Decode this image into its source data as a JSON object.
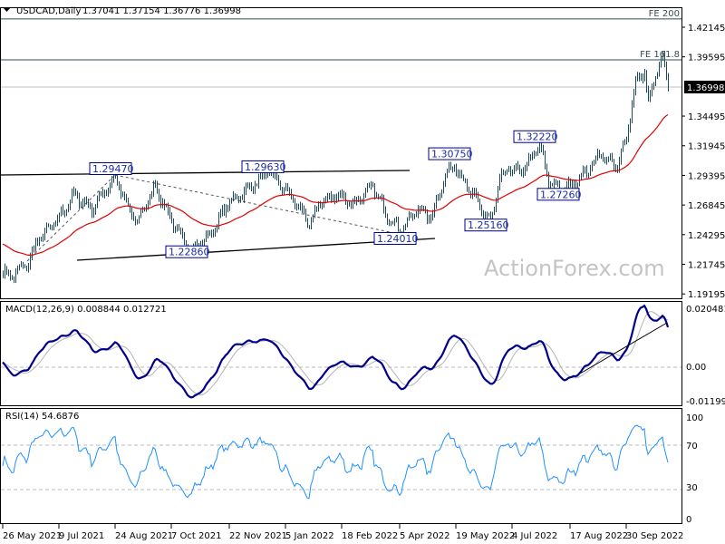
{
  "header": {
    "symbol": "USDCAD,Daily",
    "ohlc": "1.37041 1.37154 1.36776 1.36998"
  },
  "watermark": "ActionForex.com",
  "chart_data": [
    {
      "type": "ohlc",
      "title": "USDCAD,Daily",
      "ylim": [
        1.1882,
        1.4386
      ],
      "yticks": [
        "1.42145",
        "1.39595",
        "1.34495",
        "1.31945",
        "1.29395",
        "1.26845",
        "1.24295",
        "1.21745",
        "1.19195"
      ],
      "ytick_values": [
        1.42145,
        1.39595,
        1.34495,
        1.31945,
        1.29395,
        1.26845,
        1.24295,
        1.21745,
        1.19195
      ],
      "current_price": "1.36998",
      "current_value": 1.36998,
      "bars": 368,
      "close_keypoints": [
        [
          0,
          1.2109
        ],
        [
          4,
          1.207
        ],
        [
          14,
          1.2186
        ],
        [
          19,
          1.2381
        ],
        [
          29,
          1.2537
        ],
        [
          39,
          1.2771
        ],
        [
          49,
          1.2654
        ],
        [
          62,
          1.2927
        ],
        [
          69,
          1.2654
        ],
        [
          74,
          1.2537
        ],
        [
          84,
          1.2849
        ],
        [
          91,
          1.2615
        ],
        [
          99,
          1.2381
        ],
        [
          104,
          1.2303
        ],
        [
          114,
          1.242
        ],
        [
          124,
          1.2693
        ],
        [
          134,
          1.281
        ],
        [
          146,
          1.2966
        ],
        [
          154,
          1.2849
        ],
        [
          164,
          1.2654
        ],
        [
          169,
          1.2498
        ],
        [
          174,
          1.2693
        ],
        [
          184,
          1.2771
        ],
        [
          194,
          1.2693
        ],
        [
          204,
          1.2849
        ],
        [
          211,
          1.2615
        ],
        [
          219,
          1.2459
        ],
        [
          229,
          1.2654
        ],
        [
          236,
          1.2576
        ],
        [
          244,
          1.2927
        ],
        [
          249,
          1.3045
        ],
        [
          254,
          1.2888
        ],
        [
          259,
          1.2771
        ],
        [
          264,
          1.2654
        ],
        [
          269,
          1.2537
        ],
        [
          274,
          1.2888
        ],
        [
          279,
          1.3006
        ],
        [
          286,
          1.2966
        ],
        [
          296,
          1.3201
        ],
        [
          301,
          1.2888
        ],
        [
          309,
          1.281
        ],
        [
          316,
          1.2888
        ],
        [
          324,
          1.3006
        ],
        [
          329,
          1.3123
        ],
        [
          339,
          1.3006
        ],
        [
          344,
          1.3278
        ],
        [
          349,
          1.3746
        ],
        [
          354,
          1.3824
        ],
        [
          356,
          1.3551
        ],
        [
          361,
          1.3863
        ],
        [
          364,
          1.3941
        ],
        [
          367,
          1.36998
        ]
      ],
      "moving_average_color": "#e00000",
      "bar_color": "#1f4a5e",
      "levels": [
        {
          "label": "FE 200",
          "value": 1.4286
        },
        {
          "label": "FE 161.8",
          "value": 1.3934
        }
      ],
      "price_labels": [
        {
          "text": "1.29470",
          "bar": 62,
          "value": 1.2947
        },
        {
          "text": "1.29630",
          "bar": 146,
          "value": 1.2963
        },
        {
          "text": "1.22860",
          "bar": 104,
          "value": 1.2286
        },
        {
          "text": "1.30750",
          "bar": 249,
          "value": 1.3075
        },
        {
          "text": "1.24010",
          "bar": 219,
          "value": 1.2401
        },
        {
          "text": "1.32220",
          "bar": 296,
          "value": 1.3222
        },
        {
          "text": "1.25160",
          "bar": 269,
          "value": 1.2516
        },
        {
          "text": "1.27260",
          "bar": 309,
          "value": 1.2726
        }
      ],
      "x_labels": [
        "26 May 2021",
        "9 Jul 2021",
        "24 Aug 2021",
        "7 Oct 2021",
        "22 Nov 2021",
        "5 Jan 2022",
        "18 Feb 2022",
        "5 Apr 2022",
        "19 May 2022",
        "4 Jul 2022",
        "17 Aug 2022",
        "30 Sep 2022"
      ],
      "x_label_bars": [
        0,
        31,
        62,
        93,
        125,
        156,
        187,
        219,
        250,
        281,
        313,
        344
      ]
    },
    {
      "type": "line",
      "title": "MACD(12,26,9) 0.008844 0.012721",
      "ylim": [
        -0.01323,
        0.02234
      ],
      "yticks": [
        "0.020481",
        "0.00",
        "-0.011993"
      ],
      "ytick_values": [
        0.020481,
        0,
        -0.011993
      ],
      "series": [
        {
          "name": "MACD",
          "color": "#00008b"
        },
        {
          "name": "Signal",
          "color": "#b4b4b4"
        }
      ]
    },
    {
      "type": "line",
      "title": "RSI(14) 54.6876",
      "ylim": [
        0,
        100
      ],
      "yticks": [
        "100",
        "70",
        "30",
        "0"
      ],
      "ytick_values": [
        100,
        70,
        30,
        0
      ],
      "series": [
        {
          "name": "RSI",
          "color": "#1e90ff"
        }
      ]
    }
  ]
}
